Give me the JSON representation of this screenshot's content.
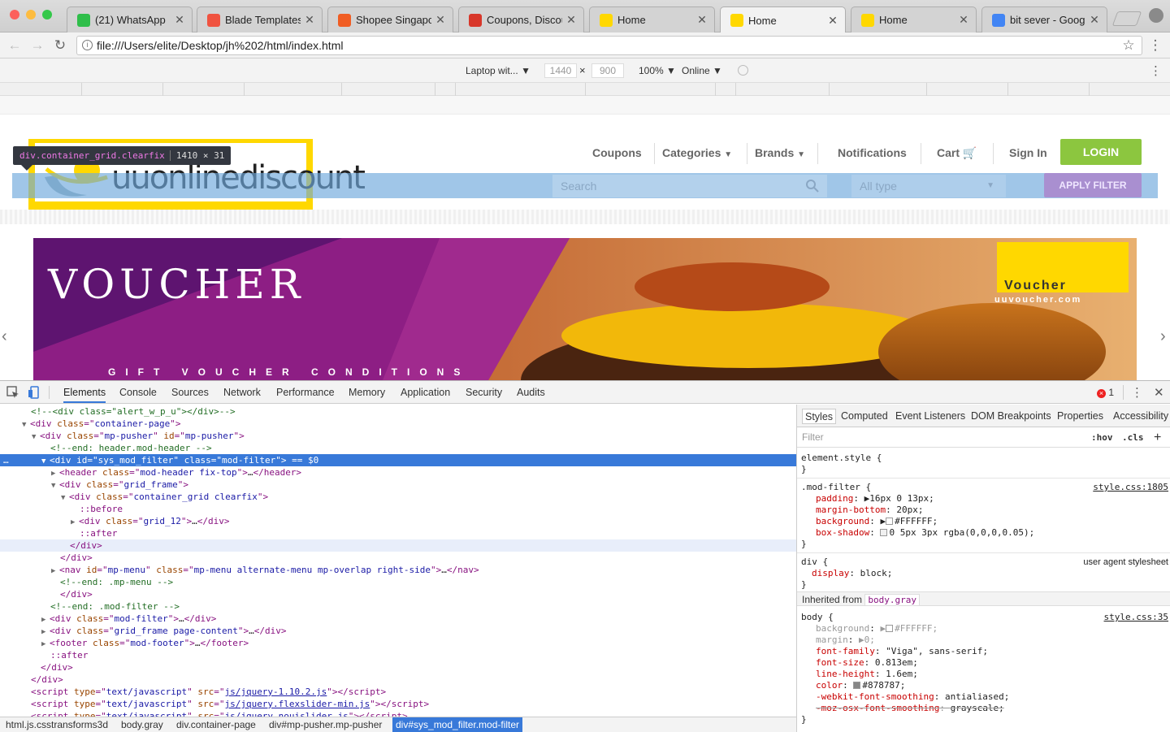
{
  "browser": {
    "tabs": [
      {
        "label": "(21) WhatsApp",
        "icon": "whatsapp-icon",
        "color": "#2fbe4a"
      },
      {
        "label": "Blade Templates - ",
        "icon": "laravel-icon",
        "color": "#f05340"
      },
      {
        "label": "Shopee Singapore",
        "icon": "shopee-icon",
        "color": "#f05d23"
      },
      {
        "label": "Coupons, Discoun",
        "icon": "coupon-icon",
        "color": "#d8372a"
      },
      {
        "label": "Home",
        "icon": "uu-icon",
        "color": "#ffd800"
      },
      {
        "label": "Home",
        "icon": "uu-icon",
        "color": "#ffd800"
      },
      {
        "label": "Home",
        "icon": "uu-icon",
        "color": "#ffd800"
      },
      {
        "label": "bit sever - Google",
        "icon": "google-icon",
        "color": "#4285f4"
      }
    ],
    "address": "file:///Users/elite/Desktop/jh%202/html/index.html"
  },
  "device_bar": {
    "device": "Laptop wit...",
    "width": "1440",
    "height": "900",
    "zoom": "100%",
    "network": "Online"
  },
  "page": {
    "tooltip_selector": "div.container_grid.clearfix",
    "tooltip_size": "1410 × 31",
    "logo_text": "uuonlinediscount",
    "nav": [
      "Coupons",
      "Categories",
      "Brands",
      "Notifications",
      "Cart",
      "Sign In"
    ],
    "login_label": "LOGIN",
    "search_placeholder": "Search",
    "type_select": "All type",
    "apply_label": "APPLY FILTER",
    "banner": {
      "headline": "VOUCHER",
      "subline": "GIFT VOUCHER CONDITIONS",
      "badge_title": "Voucher",
      "badge_url": "uuvoucher.com"
    },
    "colors": {
      "accent_green": "#8cc63f",
      "logo_yellow": "#ffd800",
      "highlight_blue": "#6fa8dc",
      "banner_purple": "#6a1a7a"
    }
  },
  "devtools": {
    "tabs": [
      "Elements",
      "Console",
      "Sources",
      "Network",
      "Performance",
      "Memory",
      "Application",
      "Security",
      "Audits"
    ],
    "error_count": "1",
    "dom_lines": [
      {
        "html": "<span class='cm'>&lt;!--&lt;div class=\"alert_w_p_u\"&gt;&lt;/div&gt;--&gt;</span>"
      },
      {
        "html": "<span class='tri'>▼</span><span class='tg'>&lt;div </span><span class='at'>class</span><span class='tg'>=\"</span><span class='av'>container-page</span><span class='tg'>\"&gt;</span>"
      },
      {
        "html": "<span class='tri'>▼</span><span class='tg'>&lt;div </span><span class='at'>class</span><span class='tg'>=\"</span><span class='av'>mp-pusher</span><span class='tg'>\" </span><span class='at'>id</span><span class='tg'>=\"</span><span class='av'>mp-pusher</span><span class='tg'>\"&gt;</span>"
      },
      {
        "html": "<span class='cm'>&lt;!--end: header.mod-header --&gt;</span>"
      },
      {
        "html": "<span class='tri'>▼</span><span class='tg'>&lt;div </span><span class='at'>id</span><span class='tg'>=\"</span><span class='av'>sys_mod_filter</span><span class='tg'>\" </span><span class='at'>class</span><span class='tg'>=\"</span><span class='av'>mod-filter</span><span class='tg'>\"&gt;</span><span class='tx'> == $0</span>"
      },
      {
        "html": "<span class='tri'>▶</span><span class='tg'>&lt;header </span><span class='at'>class</span><span class='tg'>=\"</span><span class='av'>mod-header fix-top</span><span class='tg'>\"&gt;</span><span class='tx'>…</span><span class='tg'>&lt;/header&gt;</span>"
      },
      {
        "html": "<span class='tri'>▼</span><span class='tg'>&lt;div </span><span class='at'>class</span><span class='tg'>=\"</span><span class='av'>grid_frame</span><span class='tg'>\"&gt;</span>"
      },
      {
        "html": "<span class='tri'>▼</span><span class='tg'>&lt;div </span><span class='at'>class</span><span class='tg'>=\"</span><span class='av'>container_grid clearfix</span><span class='tg'>\"&gt;</span>"
      },
      {
        "html": "<span class='pe'>::before</span>"
      },
      {
        "html": "<span class='tri'>▶</span><span class='tg'>&lt;div </span><span class='at'>class</span><span class='tg'>=\"</span><span class='av'>grid_12</span><span class='tg'>\"&gt;</span><span class='tx'>…</span><span class='tg'>&lt;/div&gt;</span>"
      },
      {
        "html": "<span class='pe'>::after</span>"
      },
      {
        "html": "<span class='tg'>&lt;/div&gt;</span>"
      },
      {
        "html": "<span class='tg'>&lt;/div&gt;</span>"
      },
      {
        "html": "<span class='tri'>▶</span><span class='tg'>&lt;nav </span><span class='at'>id</span><span class='tg'>=\"</span><span class='av'>mp-menu</span><span class='tg'>\" </span><span class='at'>class</span><span class='tg'>=\"</span><span class='av'>mp-menu alternate-menu mp-overlap right-side</span><span class='tg'>\"&gt;</span><span class='tx'>…</span><span class='tg'>&lt;/nav&gt;</span>"
      },
      {
        "html": "<span class='cm'>&lt;!--end: .mp-menu --&gt;</span>"
      },
      {
        "html": "<span class='tg'>&lt;/div&gt;</span>"
      },
      {
        "html": "<span class='cm'>&lt;!--end: .mod-filter --&gt;</span>"
      },
      {
        "html": "<span class='tri'>▶</span><span class='tg'>&lt;div </span><span class='at'>class</span><span class='tg'>=\"</span><span class='av'>mod-filter</span><span class='tg'>\"&gt;</span><span class='tx'>…</span><span class='tg'>&lt;/div&gt;</span>"
      },
      {
        "html": "<span class='tri'>▶</span><span class='tg'>&lt;div </span><span class='at'>class</span><span class='tg'>=\"</span><span class='av'>grid_frame page-content</span><span class='tg'>\"&gt;</span><span class='tx'>…</span><span class='tg'>&lt;/div&gt;</span>"
      },
      {
        "html": "<span class='tri'>▶</span><span class='tg'>&lt;footer </span><span class='at'>class</span><span class='tg'>=\"</span><span class='av'>mod-footer</span><span class='tg'>\"&gt;</span><span class='tx'>…</span><span class='tg'>&lt;/footer&gt;</span>"
      },
      {
        "html": "<span class='pe'>::after</span>"
      },
      {
        "html": "<span class='tg'>&lt;/div&gt;</span>"
      },
      {
        "html": "<span class='tg'>&lt;/div&gt;</span>"
      },
      {
        "html": "<span class='tg'>&lt;script </span><span class='at'>type</span><span class='tg'>=\"</span><span class='av'>text/javascript</span><span class='tg'>\" </span><span class='at'>src</span><span class='tg'>=\"</span><span class='lk'>js/jquery-1.10.2.js</span><span class='tg'>\"&gt;&lt;/script&gt;</span>"
      },
      {
        "html": "<span class='tg'>&lt;script </span><span class='at'>type</span><span class='tg'>=\"</span><span class='av'>text/javascript</span><span class='tg'>\" </span><span class='at'>src</span><span class='tg'>=\"</span><span class='lk'>js/jquery.flexslider-min.js</span><span class='tg'>\"&gt;&lt;/script&gt;</span>"
      },
      {
        "html": "<span class='tg'>&lt;script </span><span class='at'>type</span><span class='tg'>=\"</span><span class='av'>text/javascript</span><span class='tg'>\" </span><span class='at'>src</span><span class='tg'>=\"</span><span class='lk'>js/jquery.nouislider.js</span><span class='tg'>\"&gt;&lt;/script&gt;</span>"
      }
    ],
    "breadcrumbs": [
      "html.js.csstransforms3d",
      "body.gray",
      "div.container-page",
      "div#mp-pusher.mp-pusher",
      "div#sys_mod_filter.mod-filter"
    ],
    "styles_tabs": [
      "Styles",
      "Computed",
      "Event Listeners",
      "DOM Breakpoints",
      "Properties",
      "Accessibility"
    ],
    "filter_placeholder": "Filter",
    "hov": ":hov",
    "cls": ".cls",
    "element_style": "element.style {",
    "close_brace": "}",
    "mod_filter_selector": ".mod-filter {",
    "mod_filter_source": "style.css:1805",
    "mod_filter_props": [
      {
        "name": "padding",
        "value": "16px 0 13px;"
      },
      {
        "name": "margin-bottom",
        "value": "20px;"
      },
      {
        "name": "background",
        "value": "#FFFFFF;"
      },
      {
        "name": "box-shadow",
        "value": "0 5px 3px rgba(0,0,0,0.05);"
      }
    ],
    "div_selector": "div {",
    "div_source": "user agent stylesheet",
    "div_prop": {
      "name": "display",
      "value": "block;"
    },
    "inherited_label": "Inherited from",
    "inherited_from": "body.gray",
    "body_selector": "body {",
    "body_source": "style.css:35",
    "body_props": [
      {
        "name": "background",
        "value": "#FFFFFF;"
      },
      {
        "name": "margin",
        "value": "0;"
      },
      {
        "name": "font-family",
        "value": "\"Viga\", sans-serif;"
      },
      {
        "name": "font-size",
        "value": "0.813em;"
      },
      {
        "name": "line-height",
        "value": "1.6em;"
      },
      {
        "name": "color",
        "value": "#878787;"
      },
      {
        "name": "-webkit-font-smoothing",
        "value": "antialiased;"
      },
      {
        "name": "-moz-osx-font-smoothing",
        "value": "grayscale;"
      }
    ]
  }
}
